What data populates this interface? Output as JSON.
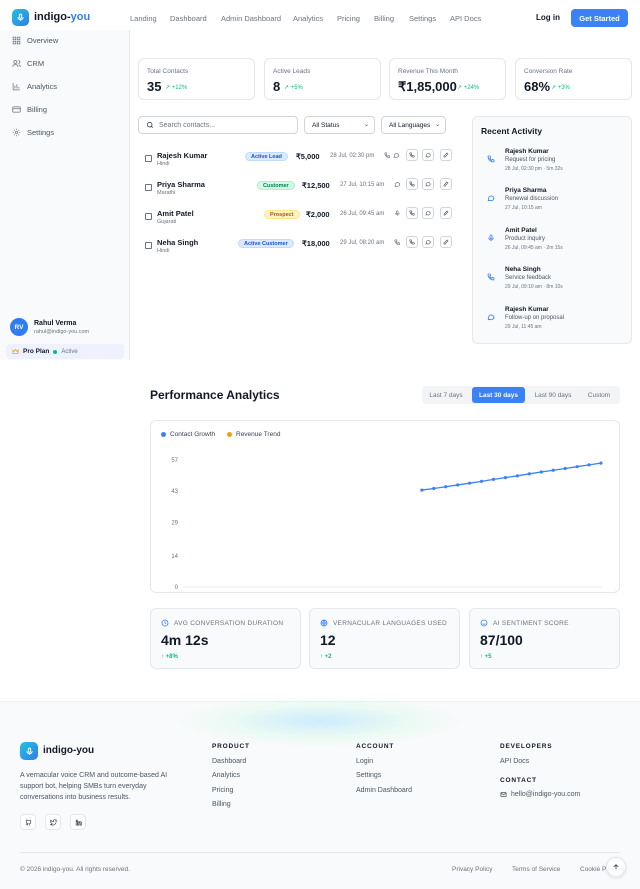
{
  "nav": {
    "brand_a": "indigo-",
    "brand_b": "you",
    "links": [
      "Landing",
      "Dashboard",
      "Admin Dashboard",
      "Analytics",
      "Pricing",
      "Billing",
      "Settings",
      "API Docs"
    ],
    "login": "Log in",
    "cta": "Get Started"
  },
  "sidebar": {
    "items": [
      {
        "label": "Overview",
        "icon": "grid-icon"
      },
      {
        "label": "CRM",
        "icon": "users-icon"
      },
      {
        "label": "Analytics",
        "icon": "bar-chart-icon"
      },
      {
        "label": "Billing",
        "icon": "credit-card-icon"
      },
      {
        "label": "Settings",
        "icon": "gear-icon"
      }
    ],
    "user": {
      "initials": "RV",
      "name": "Rahul Verma",
      "email": "rahul@indigo-you.com"
    },
    "plan": {
      "name": "Pro Plan",
      "status": "Active"
    }
  },
  "stats": [
    {
      "label": "Total Contacts",
      "value": "35",
      "change": "+12%"
    },
    {
      "label": "Active Leads",
      "value": "8",
      "change": "+5%"
    },
    {
      "label": "Revenue This Month",
      "value": "₹1,85,000",
      "change": "+24%"
    },
    {
      "label": "Conversion Rate",
      "value": "68%",
      "change": "+3%"
    }
  ],
  "filters": {
    "search_placeholder": "Search contacts...",
    "status": "All Status",
    "languages": "All Languages"
  },
  "contacts": [
    {
      "name": "Rajesh Kumar",
      "language": "Hindi",
      "badge": "Active Lead",
      "amount": "₹5,000",
      "date": "28 Jul, 02:30 pm"
    },
    {
      "name": "Priya Sharma",
      "language": "Marathi",
      "badge": "Customer",
      "amount": "₹12,500",
      "date": "27 Jul, 10:15 am"
    },
    {
      "name": "Amit Patel",
      "language": "Gujarati",
      "badge": "Prospect",
      "amount": "₹2,000",
      "date": "26 Jul, 09:45 am"
    },
    {
      "name": "Neha Singh",
      "language": "Hindi",
      "badge": "Active Customer",
      "amount": "₹18,000",
      "date": "29 Jul, 08:20 am"
    }
  ],
  "recent": {
    "title": "Recent Activity",
    "items": [
      {
        "name": "Rajesh Kumar",
        "desc": "Request for pricing",
        "meta": "28 Jul, 02:30 pm · 5m 32s",
        "icon": "phone-icon"
      },
      {
        "name": "Priya Sharma",
        "desc": "Renewal discussion",
        "meta": "27 Jul, 10:15 am",
        "icon": "message-icon"
      },
      {
        "name": "Amit Patel",
        "desc": "Product inquiry",
        "meta": "26 Jul, 09:45 am · 2m 15s",
        "icon": "mic-icon"
      },
      {
        "name": "Neha Singh",
        "desc": "Service feedback",
        "meta": "29 Jul, 09:10 am · 8m 10s",
        "icon": "phone-icon"
      },
      {
        "name": "Rajesh Kumar",
        "desc": "Follow-up on proposal",
        "meta": "29 Jul, 11:45 am",
        "icon": "message-icon"
      }
    ]
  },
  "performance": {
    "title": "Performance Analytics",
    "tabs": [
      "Last 7 days",
      "Last 30 days",
      "Last 90 days",
      "Custom"
    ],
    "active_tab": "Last 30 days"
  },
  "chart_data": {
    "type": "line",
    "title": "",
    "xlabel": "",
    "ylabel": "",
    "y_ticks": [
      0,
      14,
      29,
      43,
      57
    ],
    "ylim": [
      0,
      57
    ],
    "grid": false,
    "legend_position": "top-left",
    "series": [
      {
        "name": "Contact Growth",
        "color": "#3b82f6",
        "x": [
          20,
          21,
          22,
          23,
          24,
          25,
          26,
          27,
          28,
          29,
          30,
          31,
          32,
          33,
          34,
          35
        ],
        "values": [
          43.5,
          44.2,
          45.0,
          45.8,
          46.6,
          47.4,
          48.3,
          49.1,
          49.9,
          50.8,
          51.6,
          52.4,
          53.2,
          54.0,
          54.8,
          55.6
        ]
      },
      {
        "name": "Revenue Trend",
        "color": "#f59e0b",
        "x": [],
        "values": []
      }
    ],
    "x_count": 35
  },
  "metrics": [
    {
      "label": "AVG CONVERSATION DURATION",
      "value": "4m 12s",
      "change": "+8%",
      "icon": "clock-icon"
    },
    {
      "label": "VERNACULAR LANGUAGES USED",
      "value": "12",
      "change": "+2",
      "icon": "globe-icon"
    },
    {
      "label": "AI SENTIMENT SCORE",
      "value": "87/100",
      "change": "+5",
      "icon": "smile-icon"
    }
  ],
  "footer": {
    "brand": "indigo-you",
    "desc": "A vernacular voice CRM and outcome-based AI support bot, helping SMBs turn everyday conversations into business results.",
    "product_head": "PRODUCT",
    "product_links": [
      "Dashboard",
      "Analytics",
      "Pricing",
      "Billing"
    ],
    "account_head": "ACCOUNT",
    "account_links": [
      "Login",
      "Settings",
      "Admin Dashboard"
    ],
    "dev_head": "DEVELOPERS",
    "dev_links": [
      "API Docs"
    ],
    "contact_head": "CONTACT",
    "email": "hello@indigo-you.com",
    "copyright": "© 2026 indigo-you. All rights reserved.",
    "legal": [
      "Privacy Policy",
      "Terms of Service",
      "Cookie P"
    ]
  }
}
